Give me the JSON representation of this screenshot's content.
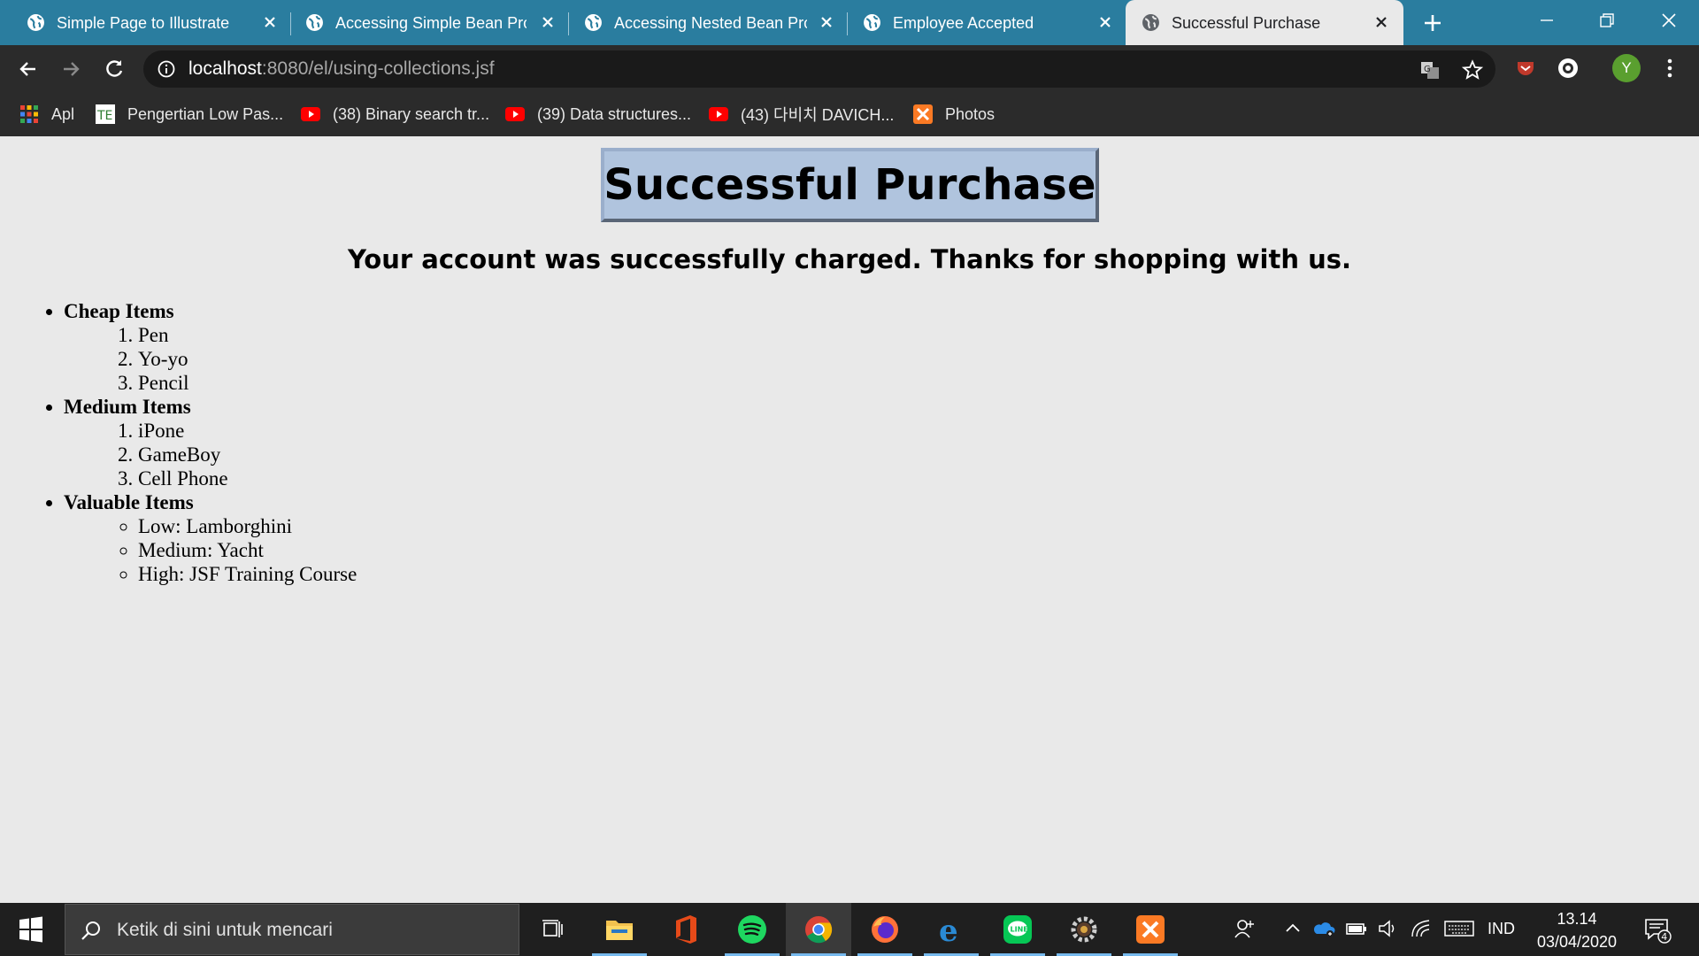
{
  "browser": {
    "tabs": [
      {
        "title": "Simple Page to Illustrate Te",
        "active": false
      },
      {
        "title": "Accessing Simple Bean Prop",
        "active": false
      },
      {
        "title": "Accessing Nested Bean Prop",
        "active": false
      },
      {
        "title": "Employee Accepted",
        "active": false
      },
      {
        "title": "Successful Purchase",
        "active": true
      }
    ],
    "url_host": "localhost",
    "url_path": ":8080/el/using-collections.jsf",
    "profile_initial": "Y",
    "bookmarks": [
      {
        "label": "Apl",
        "icon": "apps-grid-icon"
      },
      {
        "label": "Pengertian Low Pas...",
        "icon": "te-site-icon"
      },
      {
        "label": "(38) Binary search tr...",
        "icon": "youtube-icon"
      },
      {
        "label": "(39) Data structures...",
        "icon": "youtube-icon"
      },
      {
        "label": "(43) 다비치 DAVICH...",
        "icon": "youtube-icon"
      },
      {
        "label": "Photos",
        "icon": "xampp-icon"
      }
    ]
  },
  "page": {
    "heading": "Successful Purchase",
    "subheading": "Your account was successfully charged. Thanks for shopping with us.",
    "groups": [
      {
        "name": "Cheap Items",
        "list_type": "ordered",
        "items": [
          "Pen",
          "Yo-yo",
          "Pencil"
        ]
      },
      {
        "name": "Medium Items",
        "list_type": "ordered",
        "items": [
          "iPone",
          "GameBoy",
          "Cell Phone"
        ]
      },
      {
        "name": "Valuable Items",
        "list_type": "unordered",
        "items": [
          "Low: Lamborghini",
          "Medium: Yacht",
          "High: JSF Training Course"
        ]
      }
    ]
  },
  "taskbar": {
    "search_placeholder": "Ketik di sini untuk mencari",
    "language": "IND",
    "time": "13.14",
    "date": "03/04/2020",
    "notification_count": "4",
    "apps": [
      "task-view",
      "file-explorer",
      "office",
      "spotify",
      "chrome",
      "firefox",
      "edge",
      "line",
      "settings",
      "xampp"
    ]
  },
  "colors": {
    "tab_strip": "#2a7d9f",
    "toolbar": "#2b2b2b",
    "page_background": "#e9e9e9",
    "heading_box": "#b0c4de",
    "taskbar": "#1f1f1f"
  }
}
